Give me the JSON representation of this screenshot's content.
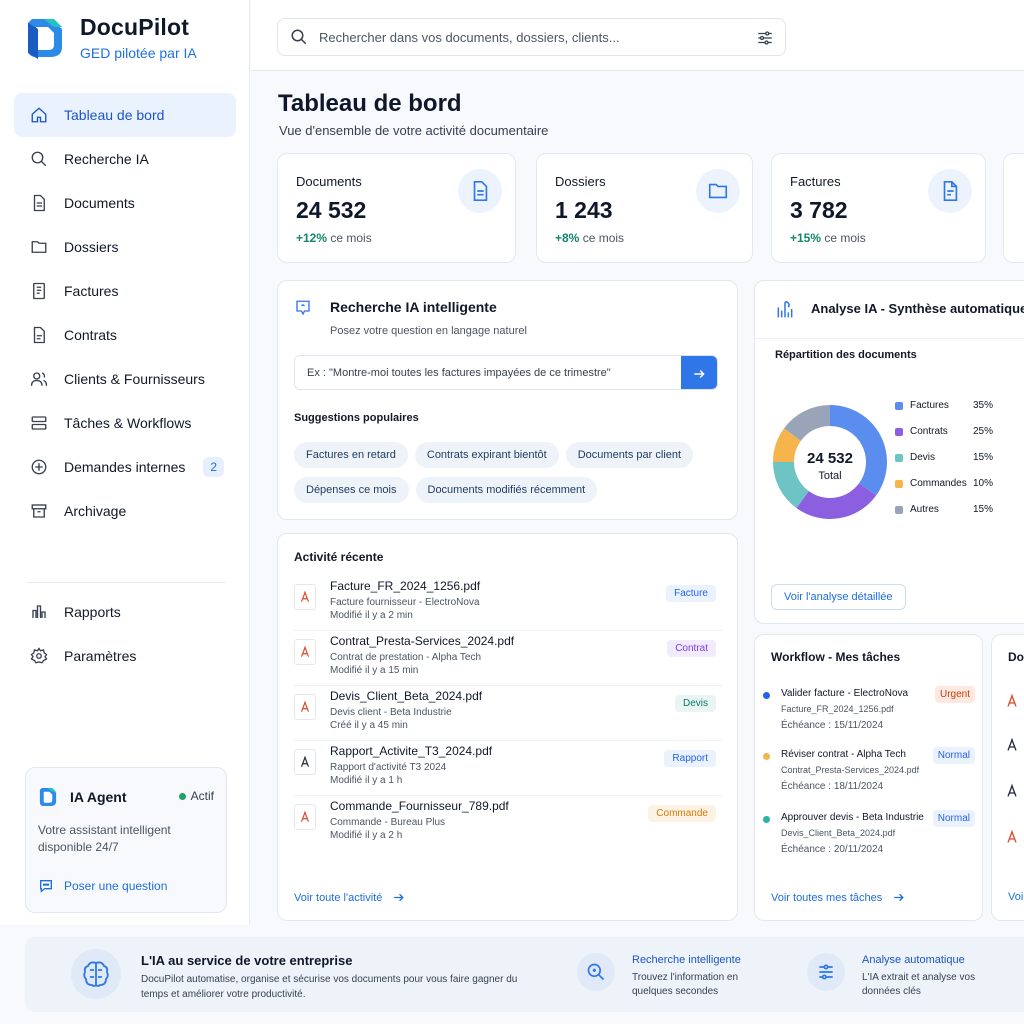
{
  "brand": {
    "name": "DocuPilot",
    "tagline": "GED pilotée par IA"
  },
  "search": {
    "placeholder": "Rechercher dans vos documents, dossiers, clients..."
  },
  "nav": [
    {
      "label": "Tableau de bord",
      "icon": "home-icon",
      "active": true
    },
    {
      "label": "Recherche IA",
      "icon": "search-icon"
    },
    {
      "label": "Documents",
      "icon": "document-icon"
    },
    {
      "label": "Dossiers",
      "icon": "folder-icon"
    },
    {
      "label": "Factures",
      "icon": "invoice-icon"
    },
    {
      "label": "Contrats",
      "icon": "contract-icon"
    },
    {
      "label": "Clients & Fournisseurs",
      "icon": "users-icon"
    },
    {
      "label": "Tâches & Workflows",
      "icon": "workflow-icon"
    },
    {
      "label": "Demandes internes",
      "icon": "request-icon",
      "badge": "2"
    },
    {
      "label": "Archivage",
      "icon": "archive-icon"
    }
  ],
  "nav_secondary": [
    {
      "label": "Rapports",
      "icon": "chart-icon"
    },
    {
      "label": "Paramètres",
      "icon": "gear-icon"
    }
  ],
  "agent": {
    "title": "IA Agent",
    "status": "Actif",
    "description": "Votre assistant intelligent disponible 24/7",
    "link": "Poser une question"
  },
  "page": {
    "title": "Tableau de bord",
    "subtitle": "Vue d'ensemble de votre activité documentaire"
  },
  "stats": [
    {
      "label": "Documents",
      "value": "24 532",
      "trend": "+12%",
      "trend_suffix": "ce mois",
      "icon": "document-icon"
    },
    {
      "label": "Dossiers",
      "value": "1 243",
      "trend": "+8%",
      "trend_suffix": "ce mois",
      "icon": "folder-icon"
    },
    {
      "label": "Factures",
      "value": "3 782",
      "trend": "+15%",
      "trend_suffix": "ce mois",
      "icon": "invoice-icon"
    }
  ],
  "ai_search": {
    "title": "Recherche IA intelligente",
    "subtitle": "Posez votre question en langage naturel",
    "placeholder": "Ex : \"Montre-moi toutes les factures impayées de ce trimestre\"",
    "suggestions_title": "Suggestions populaires",
    "suggestions": [
      "Factures en retard",
      "Contrats expirant bientôt",
      "Documents par client",
      "Dépenses ce mois",
      "Documents modifiés récemment"
    ]
  },
  "activity": {
    "title": "Activité récente",
    "items": [
      {
        "name": "Facture_FR_2024_1256.pdf",
        "desc": "Facture fournisseur - ElectroNova",
        "time": "Modifié il y a 2 min",
        "tag": "Facture",
        "tag_color": "#2563eb",
        "tag_bg": "#eaf2fe"
      },
      {
        "name": "Contrat_Presta-Services_2024.pdf",
        "desc": "Contrat de prestation - Alpha Tech",
        "time": "Modifié il y a 15 min",
        "tag": "Contrat",
        "tag_color": "#7c3aed",
        "tag_bg": "#f1ecfd"
      },
      {
        "name": "Devis_Client_Beta_2024.pdf",
        "desc": "Devis client - Beta Industrie",
        "time": "Créé il y a 45 min",
        "tag": "Devis",
        "tag_color": "#0f766e",
        "tag_bg": "#e8f5f3"
      },
      {
        "name": "Rapport_Activite_T3_2024.pdf",
        "desc": "Rapport d'activité T3 2024",
        "time": "Modifié il y a 1 h",
        "tag": "Rapport",
        "tag_color": "#2563eb",
        "tag_bg": "#eaf2fe"
      },
      {
        "name": "Commande_Fournisseur_789.pdf",
        "desc": "Commande - Bureau Plus",
        "time": "Modifié il y a 2 h",
        "tag": "Commande",
        "tag_color": "#d97706",
        "tag_bg": "#fdf3e4"
      }
    ],
    "more": "Voir toute l'activité"
  },
  "analysis": {
    "title": "Analyse IA - Synthèse automatique",
    "subtitle": "Répartition des documents",
    "button": "Voir l'analyse détaillée"
  },
  "chart_data": {
    "type": "pie",
    "title": "Répartition des documents",
    "center_value": "24 532",
    "center_label": "Total",
    "categories": [
      "Factures",
      "Contrats",
      "Devis",
      "Commandes",
      "Autres"
    ],
    "values": [
      35,
      25,
      15,
      10,
      15
    ],
    "labels": [
      "35%",
      "25%",
      "15%",
      "10%",
      "15%"
    ],
    "colors": [
      "#5b8def",
      "#8b5fe0",
      "#6cc4c4",
      "#f5b54c",
      "#9aa4b8"
    ]
  },
  "workflow": {
    "title": "Workflow - Mes tâches",
    "items": [
      {
        "name": "Valider facture - ElectroNova",
        "file": "Facture_FR_2024_1256.pdf",
        "due": "Échéance : 15/11/2024",
        "tag": "Urgent",
        "dot": "#2563eb",
        "tag_color": "#c2410c",
        "tag_bg": "#fde9e0"
      },
      {
        "name": "Réviser contrat - Alpha Tech",
        "file": "Contrat_Presta-Services_2024.pdf",
        "due": "Échéance : 18/11/2024",
        "tag": "Normal",
        "dot": "#f5b54c",
        "tag_color": "#2563eb",
        "tag_bg": "#eaf2fe"
      },
      {
        "name": "Approuver devis - Beta Industrie",
        "file": "Devis_Client_Beta_2024.pdf",
        "due": "Échéance : 20/11/2024",
        "tag": "Normal",
        "dot": "#2bb3a8",
        "tag_color": "#2563eb",
        "tag_bg": "#eaf2fe"
      }
    ],
    "more": "Voir toutes mes tâches"
  },
  "cut_panel": {
    "title": "Do",
    "more": "Voi"
  },
  "banner": {
    "title": "L'IA au service de votre entreprise",
    "desc": "DocuPilot automatise, organise et sécurise vos documents pour vous faire gagner du temps et améliorer votre productivité.",
    "features": [
      {
        "title": "Recherche intelligente",
        "desc": "Trouvez l'information en quelques secondes",
        "icon": "search-doc-icon"
      },
      {
        "title": "Analyse automatique",
        "desc": "L'IA extrait et analyse vos données clés",
        "icon": "analysis-icon"
      }
    ]
  }
}
